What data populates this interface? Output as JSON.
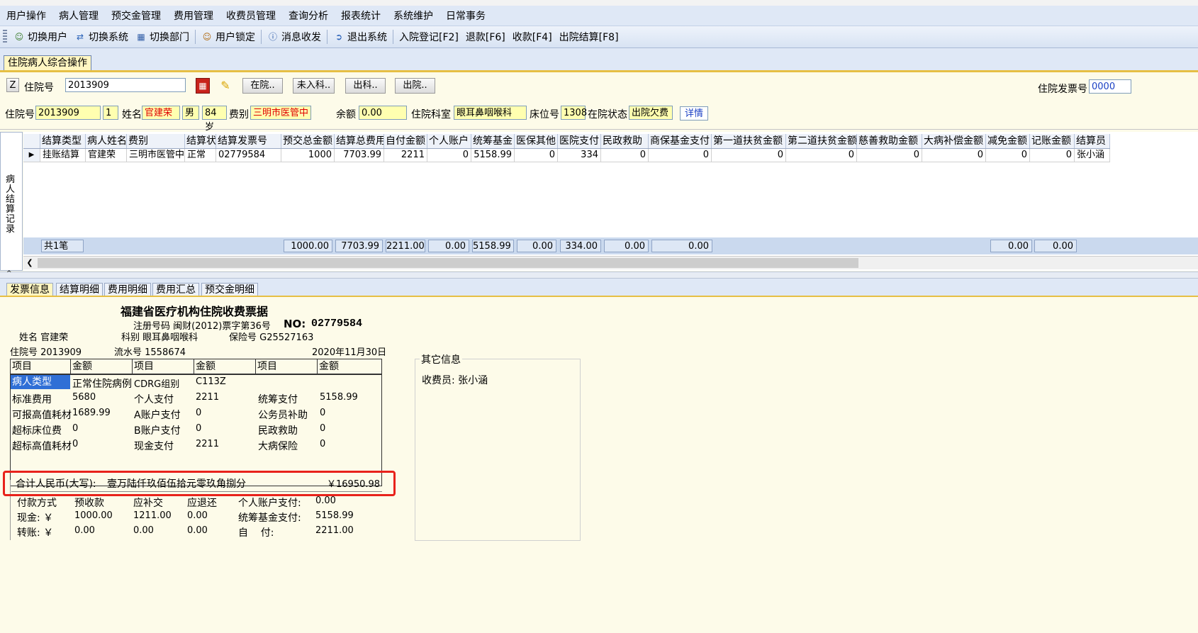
{
  "menubar": {
    "items": [
      "用户操作",
      "病人管理",
      "预交金管理",
      "费用管理",
      "收费员管理",
      "查询分析",
      "报表统计",
      "系统维护",
      "日常事务"
    ]
  },
  "toolbar": {
    "switch_user": "切换用户",
    "switch_system": "切换系统",
    "switch_dept": "切换部门",
    "lock_user": "用户锁定",
    "messages": "消息收发",
    "exit": "退出系统",
    "admit": "入院登记[F2]",
    "refund": "退款[F6]",
    "collect": "收款[F4]",
    "discharge_settle": "出院结算[F8]"
  },
  "main_tab": {
    "label": "住院病人综合操作"
  },
  "search": {
    "z_button": "Z",
    "inpatient_no_label": "住院号",
    "inpatient_no_value": "2013909",
    "btn_in_hospital": "在院..",
    "btn_not_admitted": "未入科..",
    "btn_out_dept": "出科..",
    "btn_discharged": "出院..",
    "invoice_no_label": "住院发票号",
    "invoice_no_value": "0000"
  },
  "patient": {
    "inpatient_no_label": "住院号",
    "inpatient_no": "2013909",
    "visit_count": "1",
    "name_label": "姓名",
    "name": "官建荣",
    "sex": "男",
    "age": "84岁",
    "fee_type_label": "费别",
    "fee_type": "三明市医管中",
    "balance_label": "余额",
    "balance": "0.00",
    "dept_label": "住院科室",
    "dept": "眼耳鼻咽喉科",
    "bed_label": "床位号",
    "bed": "1308",
    "status_label": "在院状态",
    "status": "出院欠费",
    "detail": "详情"
  },
  "settlement": {
    "side_label": "病人结算记录",
    "columns": [
      "结算类型",
      "病人姓名",
      "费别",
      "结算状",
      "结算发票号",
      "预交总金额",
      "结算总费用",
      "自付金额",
      "个人账户",
      "统筹基金",
      "医保其他",
      "医院支付",
      "民政救助",
      "商保基金支付",
      "第一道扶贫金额",
      "第二道扶贫金额",
      "慈善救助金额",
      "大病补偿金额",
      "减免金额",
      "记账金额",
      "结算员"
    ],
    "row": [
      "挂账结算",
      "官建荣",
      "三明市医管中",
      "正常",
      "02779584",
      "1000",
      "7703.99",
      "2211",
      "0",
      "5158.99",
      "0",
      "334",
      "0",
      "0",
      "0",
      "0",
      "0",
      "0",
      "0",
      "0",
      "张小涵"
    ],
    "footer": {
      "count": "共1笔",
      "prepay": "1000.00",
      "total": "7703.99",
      "self_pay": "2211.00",
      "personal": "0.00",
      "pooling": "5158.99",
      "other": "0.00",
      "hospital": "334.00",
      "civil": "0.00",
      "commercial": "0.00",
      "reduction": "0.00",
      "account": "0.00"
    }
  },
  "subtabs": [
    "发票信息",
    "结算明细",
    "费用明细",
    "费用汇总",
    "预交金明细"
  ],
  "receipt": {
    "title": "福建省医疗机构住院收费票据",
    "reg_code": "注册号码 闽财(2012)票字第36号",
    "no_label": "NO:",
    "no_value": "02779584",
    "name": "姓名 官建荣",
    "dept": "科别 眼耳鼻咽喉科",
    "insurance": "保险号 G25527163",
    "inpatient": "住院号 2013909",
    "serial": "流水号 1558674",
    "date": "2020年11月30日",
    "headers": [
      "项目",
      "金额",
      "项目",
      "金额",
      "项目",
      "金额"
    ],
    "rows": [
      [
        "病人类型",
        "正常住院病例",
        "CDRG组别",
        "C113Z",
        "",
        ""
      ],
      [
        "标准费用",
        "5680",
        "个人支付",
        "2211",
        "统筹支付",
        "5158.99"
      ],
      [
        "可报高值耗材",
        "1689.99",
        "A账户支付",
        "0",
        "公务员补助",
        "0"
      ],
      [
        "超标床位费",
        "0",
        "B账户支付",
        "0",
        "民政救助",
        "0"
      ],
      [
        "超标高值耗材",
        "0",
        "现金支付",
        "2211",
        "大病保险",
        "0"
      ]
    ],
    "total_label": "合计人民币(大写):",
    "total_words": "壹万陆仟玖佰伍拾元零玖角捌分",
    "total_amount": "￥16950.98",
    "pay_headers": [
      "付款方式",
      "预收款",
      "应补交",
      "应退还",
      "个人账户支付:",
      "0.00"
    ],
    "cash_row": [
      "现金: ￥",
      "1000.00",
      "1211.00",
      "0.00",
      "统筹基金支付:",
      "5158.99"
    ],
    "transfer_row": [
      "转账: ￥",
      "0.00",
      "0.00",
      "0.00",
      "自    付:",
      "2211.00"
    ]
  },
  "other_info": {
    "title": "其它信息",
    "cashier": "收费员: 张小涵"
  }
}
